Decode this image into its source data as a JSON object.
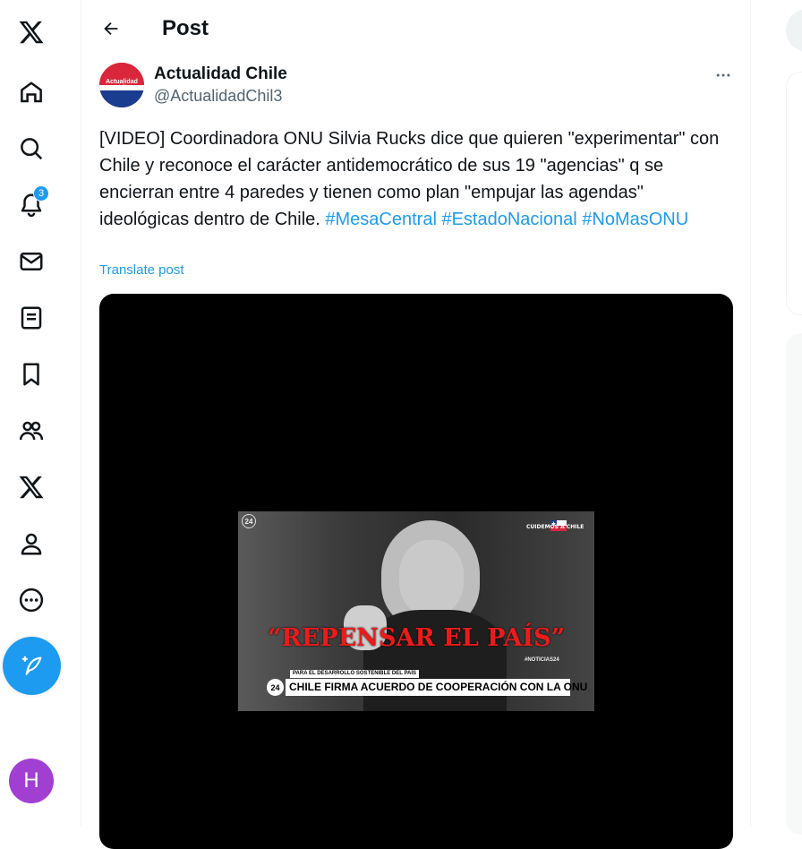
{
  "header": {
    "title": "Post"
  },
  "nav": {
    "notification_count": "3",
    "items": [
      {
        "name": "x-logo-icon"
      },
      {
        "name": "home-icon"
      },
      {
        "name": "explore-icon"
      },
      {
        "name": "notifications-icon"
      },
      {
        "name": "messages-icon"
      },
      {
        "name": "lists-icon"
      },
      {
        "name": "bookmarks-icon"
      },
      {
        "name": "communities-icon"
      },
      {
        "name": "premium-icon"
      },
      {
        "name": "profile-icon"
      },
      {
        "name": "more-icon"
      }
    ],
    "user_initial": "H"
  },
  "post": {
    "author": {
      "display_name": "Actualidad Chile",
      "handle": "@ActualidadChil3",
      "avatar_text": "Actualidad Chile"
    },
    "text": "[VIDEO] Coordinadora ONU Silvia Rucks dice que quieren \"experimentar\" con Chile y reconoce el carácter antidemocrático de sus 19 \"agencias\" q se encierran entre 4 paredes y tienen como plan \"empujar las agendas\" ideológicas dentro de Chile.",
    "hashtags": [
      "#MesaCentral",
      "#EstadoNacional",
      "#NoMasONU"
    ],
    "translate_label": "Translate post",
    "video": {
      "channel_badge": "24",
      "watermark": "CUIDEMOS A CHILE",
      "headline": "“REPENSAR EL PAÍS”",
      "hashtag_overlay": "#NOTICIAS24",
      "lower_third_small": "PARA EL DESARROLLO SOSTENIBLE DEL PAÍS",
      "lower_third_main": "CHILE FIRMA ACUERDO DE COOPERACIÓN CON LA ONU",
      "lower_third_logo": "24"
    }
  },
  "colors": {
    "accent": "#1d9bf0",
    "text": "#0f1419",
    "muted": "#536471",
    "headline_red": "#ec1b1b",
    "user_avatar": "#a23fd3"
  }
}
